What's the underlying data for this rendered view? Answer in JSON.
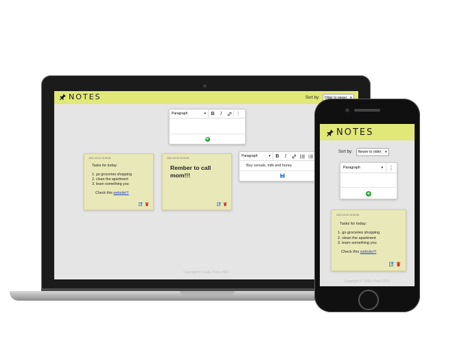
{
  "app": {
    "brand": "NOTES",
    "sort_label": "Sort by:",
    "sort_value_laptop": "Older to newer",
    "sort_value_phone": "Newer to older",
    "footer": "Copyright © Giulia Pisos 2021",
    "brand_color": "#e1e878"
  },
  "editor": {
    "block_format": "Paragraph",
    "bold": "B",
    "italic": "I",
    "more": "⋮",
    "add_label": "+"
  },
  "notes": [
    {
      "date": "2021-03-02 20:30:45",
      "heading": "Tasks for today:",
      "items": [
        "go groceries shopping",
        "clean the apartment",
        "learn something you"
      ],
      "link_prefix": "Check this ",
      "link_text": "website!!!"
    },
    {
      "date": "2021-03-02 20:30:23",
      "text": "Rember to call mom!!!"
    }
  ],
  "editing_note": {
    "text": "Buy cereals, milk and honey"
  }
}
